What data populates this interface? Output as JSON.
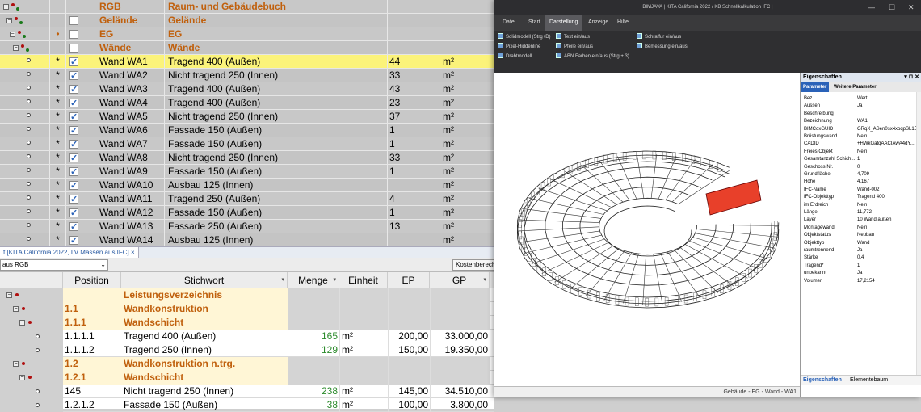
{
  "raumbuch": {
    "rows": [
      {
        "kind": "group",
        "name": "RGB",
        "desc": "Raum- und Gebäudebuch",
        "star": "",
        "checkbox": "none",
        "qty": "",
        "unit": ""
      },
      {
        "kind": "group",
        "name": "Gelände",
        "desc": "Gelände",
        "star": "",
        "checkbox": "empty",
        "qty": "",
        "unit": ""
      },
      {
        "kind": "group",
        "name": "EG",
        "desc": "EG",
        "star": "•",
        "checkbox": "empty",
        "qty": "",
        "unit": ""
      },
      {
        "kind": "group",
        "name": "Wände",
        "desc": "Wände",
        "star": "",
        "checkbox": "empty",
        "qty": "",
        "unit": ""
      },
      {
        "kind": "item",
        "selected": true,
        "name": "Wand WA1",
        "desc": "Tragend 400 (Außen)",
        "star": "*",
        "checkbox": "checked",
        "qty": "44",
        "unit": "m²"
      },
      {
        "kind": "item",
        "name": "Wand WA2",
        "desc": "Nicht tragend 250 (Innen)",
        "star": "*",
        "checkbox": "checked",
        "qty": "33",
        "unit": "m²"
      },
      {
        "kind": "item",
        "name": "Wand WA3",
        "desc": "Tragend 400 (Außen)",
        "star": "*",
        "checkbox": "checked",
        "qty": "43",
        "unit": "m²"
      },
      {
        "kind": "item",
        "name": "Wand WA4",
        "desc": "Tragend 400 (Außen)",
        "star": "*",
        "checkbox": "checked",
        "qty": "23",
        "unit": "m²"
      },
      {
        "kind": "item",
        "name": "Wand WA5",
        "desc": "Nicht tragend 250 (Innen)",
        "star": "*",
        "checkbox": "checked",
        "qty": "37",
        "unit": "m²"
      },
      {
        "kind": "item",
        "name": "Wand WA6",
        "desc": "Fassade 150 (Außen)",
        "star": "*",
        "checkbox": "checked",
        "qty": "1",
        "unit": "m²"
      },
      {
        "kind": "item",
        "name": "Wand WA7",
        "desc": "Fassade 150 (Außen)",
        "star": "*",
        "checkbox": "checked",
        "qty": "1",
        "unit": "m²"
      },
      {
        "kind": "item",
        "name": "Wand WA8",
        "desc": "Nicht tragend 250 (Innen)",
        "star": "*",
        "checkbox": "checked",
        "qty": "33",
        "unit": "m²"
      },
      {
        "kind": "item",
        "name": "Wand WA9",
        "desc": "Fassade 150 (Außen)",
        "star": "*",
        "checkbox": "checked",
        "qty": "1",
        "unit": "m²"
      },
      {
        "kind": "item",
        "name": "Wand WA10",
        "desc": "Ausbau 125 (Innen)",
        "star": "*",
        "checkbox": "checked",
        "qty": "",
        "unit": "m²"
      },
      {
        "kind": "item",
        "name": "Wand WA11",
        "desc": "Tragend 250 (Außen)",
        "star": "*",
        "checkbox": "checked",
        "qty": "4",
        "unit": "m²"
      },
      {
        "kind": "item",
        "name": "Wand WA12",
        "desc": "Fassade 150 (Außen)",
        "star": "*",
        "checkbox": "checked",
        "qty": "1",
        "unit": "m²"
      },
      {
        "kind": "item",
        "name": "Wand WA13",
        "desc": "Fassade 250 (Außen)",
        "star": "*",
        "checkbox": "checked",
        "qty": "13",
        "unit": "m²"
      },
      {
        "kind": "item",
        "name": "Wand WA14",
        "desc": "Ausbau 125 (Innen)",
        "star": "*",
        "checkbox": "checked",
        "qty": "",
        "unit": "m²"
      }
    ]
  },
  "tabbar": {
    "tab_label": "f [KITA California 2022, LV Massen aus IFC] ×"
  },
  "filterbar": {
    "select_value": "aus RGB",
    "kosten_label": "Kostenberechn"
  },
  "lv": {
    "headers": {
      "position": "Position",
      "stichwort": "Stichwort",
      "menge": "Menge",
      "einheit": "Einheit",
      "ep": "EP",
      "gp": "GP"
    },
    "rows": [
      {
        "kind": "grp",
        "position": "",
        "stichwort": "Leistungsverzeichnis",
        "menge": "",
        "einheit": "",
        "ep": "",
        "gp": ""
      },
      {
        "kind": "grp",
        "position": "1.1",
        "stichwort": "Wandkonstruktion",
        "menge": "",
        "einheit": "",
        "ep": "",
        "gp": ""
      },
      {
        "kind": "grp",
        "position": "1.1.1",
        "stichwort": "Wandschicht",
        "menge": "",
        "einheit": "",
        "ep": "",
        "gp": ""
      },
      {
        "kind": "item",
        "position": "1.1.1.1",
        "stichwort": "Tragend 400 (Außen)",
        "menge": "165",
        "einheit": "m²",
        "ep": "200,00",
        "gp": "33.000,00"
      },
      {
        "kind": "item",
        "position": "1.1.1.2",
        "stichwort": "Tragend 250 (Innen)",
        "menge": "129",
        "einheit": "m²",
        "ep": "150,00",
        "gp": "19.350,00"
      },
      {
        "kind": "grp",
        "position": "1.2",
        "stichwort": "Wandkonstruktion n.trg.",
        "menge": "",
        "einheit": "",
        "ep": "",
        "gp": ""
      },
      {
        "kind": "grp",
        "position": "1.2.1",
        "stichwort": "Wandschicht",
        "menge": "",
        "einheit": "",
        "ep": "",
        "gp": ""
      },
      {
        "kind": "item",
        "position": "145",
        "stichwort": "Nicht tragend 250 (Innen)",
        "menge": "238",
        "einheit": "m²",
        "ep": "145,00",
        "gp": "34.510,00"
      },
      {
        "kind": "item",
        "position": "1.2.1.2",
        "stichwort": "Fassade 150 (Außen)",
        "menge": "38",
        "einheit": "m²",
        "ep": "100,00",
        "gp": "3.800,00"
      }
    ]
  },
  "bim": {
    "title": "BIMJAVA | KITA California 2022 / KB Schnellkalkulation IFC |",
    "menus": [
      "Datei",
      "Start",
      "Darstellung",
      "Anzeige",
      "Hilfe"
    ],
    "active_menu": "Darstellung",
    "ribbon": {
      "col1": [
        "Solidmodell (Strg+D)",
        "Pixel-Hiddenline",
        "Drahtmodell"
      ],
      "col2": [
        "Text ein/aus",
        "Pfeile ein/aus",
        "ABN Farben ein/aus (Strg + 3)"
      ],
      "col3": [
        "Schraffur ein/aus",
        "Bemessung ein/aus"
      ]
    },
    "status_text": "Gebäude - EG - Wand - WA1",
    "highlight_color": "#e8402a"
  },
  "props": {
    "title": "Eigenschaften",
    "tabs": [
      "Parameter",
      "Weitere Parameter"
    ],
    "rows": [
      {
        "k": "Bez.",
        "v": "Wert"
      },
      {
        "k": "Aussen",
        "v": "Ja"
      },
      {
        "k": "Beschreibung",
        "v": ""
      },
      {
        "k": "Bezeichnung",
        "v": "WA1"
      },
      {
        "k": "BIMCoxGUID",
        "v": "GRqX_ASen0sx4xoqpSL15..."
      },
      {
        "k": "Brüstungswand",
        "v": "Nein"
      },
      {
        "k": "CADID",
        "v": "+HWkGatqAACIAwA4dY..."
      },
      {
        "k": "Freies Objekt",
        "v": "Nein"
      },
      {
        "k": "Gesamtanzahl Schich...",
        "v": "1"
      },
      {
        "k": "Geschoss Nr.",
        "v": "0"
      },
      {
        "k": "Grundfläche",
        "v": "4,709"
      },
      {
        "k": "Höhe",
        "v": "4,167"
      },
      {
        "k": "IFC-Name",
        "v": "Wand-002"
      },
      {
        "k": "IFC-Objekttyp",
        "v": "Tragend 400"
      },
      {
        "k": "im Erdreich",
        "v": "Nein"
      },
      {
        "k": "Länge",
        "v": "11,772"
      },
      {
        "k": "Layer",
        "v": "10 Wand außen"
      },
      {
        "k": "Montagewand",
        "v": "Nein"
      },
      {
        "k": "Objektstatus",
        "v": "Neubau"
      },
      {
        "k": "Objekttyp",
        "v": "Wand"
      },
      {
        "k": "raumtrennend",
        "v": "Ja"
      },
      {
        "k": "Stärke",
        "v": "0,4"
      },
      {
        "k": "Tragend*",
        "v": "1"
      },
      {
        "k": "unbekannt",
        "v": "Ja"
      },
      {
        "k": "Volumen",
        "v": "17,2154"
      }
    ],
    "bottom_tabs": [
      "Eigenschaften",
      "Elementebaum"
    ]
  }
}
